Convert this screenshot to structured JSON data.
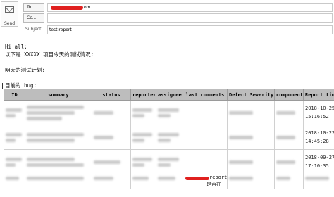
{
  "compose": {
    "send_label": "Send",
    "to_label": "To...",
    "cc_label": "Cc...",
    "subject_label": "Subject",
    "to_value_suffix": "om",
    "subject_value": "test report"
  },
  "email_body": {
    "greeting": "Hi all:",
    "line1": "以下是 XXXXX 项目今天的测试情况:",
    "line2": "明天的测试计划:",
    "line3": "目前的 bug:"
  },
  "bug_table": {
    "columns": [
      "ID",
      "summary",
      "status",
      "reporter",
      "assignee",
      "last comments",
      "Defect Severity",
      "component",
      "Report time"
    ],
    "rows": [
      {
        "report_time_date": "2018-10-25",
        "report_time_clock": "15:16:52"
      },
      {
        "report_time_date": "2018-10-22",
        "report_time_clock": "14:45:28"
      },
      {
        "report_time_date": "2018-09-27",
        "report_time_clock": "17:10:35"
      }
    ],
    "partial_row_comment": "report",
    "partial_row_comment2": "是否在"
  },
  "colors": {
    "header_bg": "#bdbdbd",
    "redaction": "#e0201f"
  }
}
